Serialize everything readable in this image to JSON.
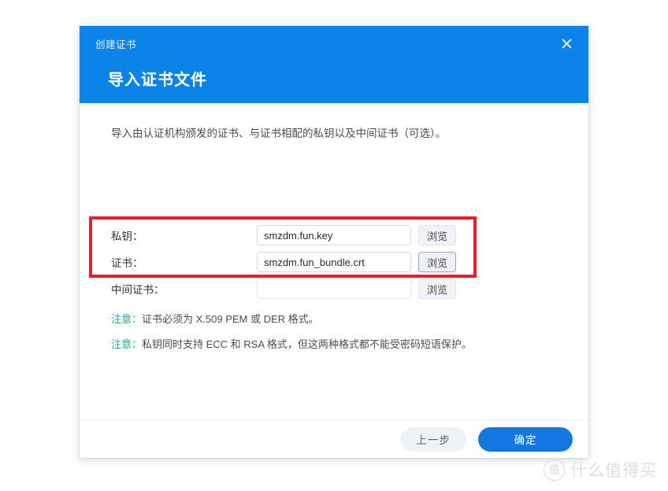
{
  "dialog": {
    "breadcrumb": "创建证书",
    "title": "导入证书文件",
    "close_icon": "close-icon",
    "intro": "导入由认证机构颁发的证书、与证书相配的私钥以及中间证书（可选）。",
    "accent_color": "#0a84e8",
    "form": {
      "rows": [
        {
          "label": "私钥：",
          "value": "smzdm.fun.key",
          "placeholder": "",
          "browse_label": "浏览",
          "browse_focused": false
        },
        {
          "label": "证书：",
          "value": "smzdm.fun_bundle.crt",
          "placeholder": "",
          "browse_label": "浏览",
          "browse_focused": true
        },
        {
          "label": "中间证书：",
          "value": "",
          "placeholder": "",
          "browse_label": "浏览",
          "browse_focused": false
        }
      ]
    },
    "notes": [
      {
        "key": "注意：",
        "text": "证书必须为 X.509 PEM 或 DER 格式。"
      },
      {
        "key": "注意：",
        "text": "私钥同时支持 ECC 和 RSA 格式，但这两种格式都不能受密码短语保护。"
      }
    ],
    "note_color": "#1f9e94",
    "footer": {
      "back_label": "上一步",
      "confirm_label": "确定"
    }
  },
  "annotation": {
    "highlight_color": "#ee1c24"
  },
  "watermark": {
    "logo_char": "值",
    "text": "什么值得买"
  }
}
